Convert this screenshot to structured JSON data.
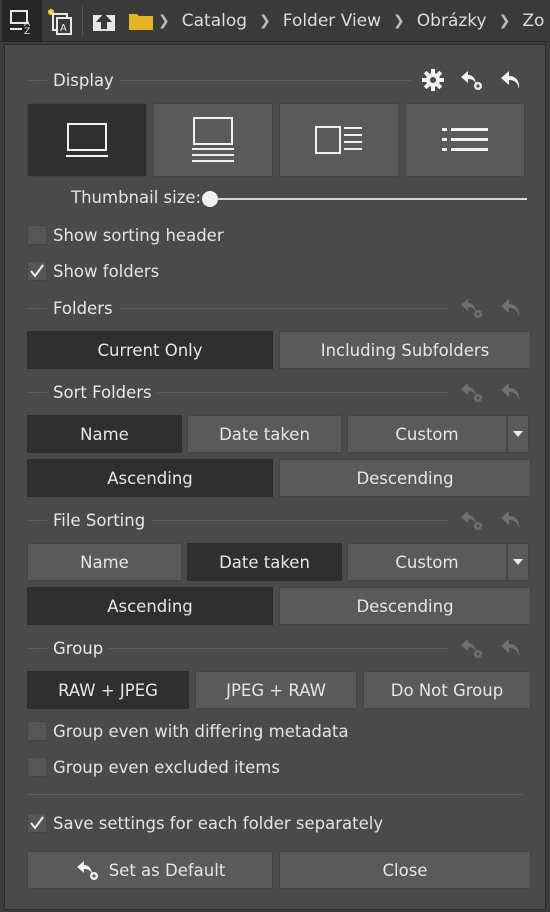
{
  "toolbar": {
    "breadcrumb": [
      "Catalog",
      "Folder View",
      "Obrázky",
      "Zo"
    ]
  },
  "display": {
    "title": "Display",
    "thumbnail_label": "Thumbnail size:",
    "thumbnail_value": 0,
    "show_sorting_header": "Show sorting header",
    "show_folders": "Show folders"
  },
  "folders": {
    "title": "Folders",
    "options": [
      "Current Only",
      "Including Subfolders"
    ]
  },
  "sort_folders": {
    "title": "Sort Folders",
    "criteria": [
      "Name",
      "Date taken",
      "Custom"
    ],
    "order": [
      "Ascending",
      "Descending"
    ]
  },
  "file_sorting": {
    "title": "File Sorting",
    "criteria": [
      "Name",
      "Date taken",
      "Custom"
    ],
    "order": [
      "Ascending",
      "Descending"
    ]
  },
  "group": {
    "title": "Group",
    "options": [
      "RAW + JPEG",
      "JPEG + RAW",
      "Do Not Group"
    ],
    "differing_metadata": "Group even with differing metadata",
    "excluded_items": "Group even excluded items"
  },
  "footer": {
    "save_separately": "Save settings for each folder separately",
    "set_default": "Set as Default",
    "close": "Close"
  }
}
